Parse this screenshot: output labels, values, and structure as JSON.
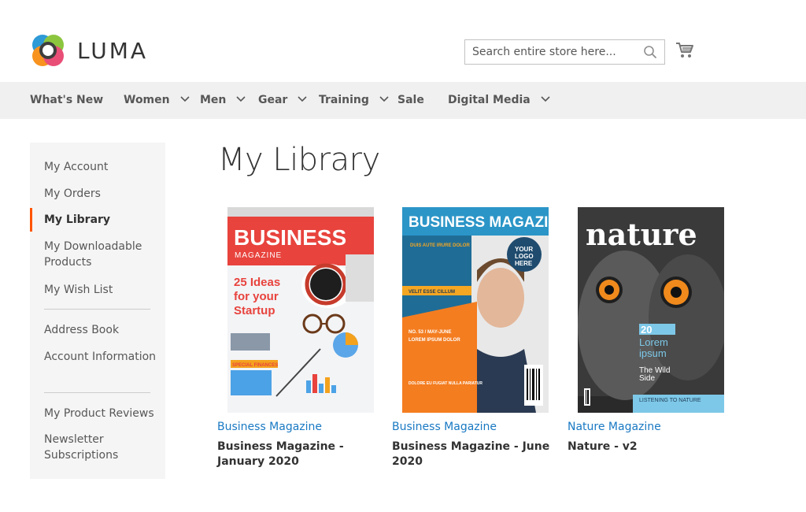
{
  "header": {
    "logo_text": "LUMA",
    "search_placeholder": "Search entire store here...",
    "search_icon": "search-icon",
    "cart_icon": "cart-icon"
  },
  "nav": {
    "items": [
      {
        "label": "What's New",
        "has_dropdown": false
      },
      {
        "label": "Women",
        "has_dropdown": true
      },
      {
        "label": "Men",
        "has_dropdown": true
      },
      {
        "label": "Gear",
        "has_dropdown": true
      },
      {
        "label": "Training",
        "has_dropdown": true
      },
      {
        "label": "Sale",
        "has_dropdown": false
      },
      {
        "label": "Digital Media",
        "has_dropdown": true
      }
    ]
  },
  "sidebar": {
    "items": [
      {
        "label": "My Account"
      },
      {
        "label": "My Orders"
      },
      {
        "label": "My Library",
        "active": true
      },
      {
        "label": "My Downloadable Products"
      },
      {
        "label": "My Wish List"
      },
      {
        "label": "Address Book"
      },
      {
        "label": "Account Information"
      },
      {
        "label": "My Product Reviews"
      },
      {
        "label": "Newsletter Subscriptions"
      }
    ]
  },
  "main": {
    "title": "My Library",
    "products": [
      {
        "category": "Business Magazine",
        "name": "Business Magazine - January 2020",
        "cover": {
          "masthead": "BUSINESS",
          "sub": "MAGAZINE",
          "headline": "25 Ideas for your Startup",
          "tag": "SPECIAL FINANCES"
        }
      },
      {
        "category": "Business Magazine",
        "name": "Business Magazine - June 2020",
        "cover": {
          "masthead": "BUSINESS MAGAZINE",
          "logo": "YOUR LOGO HERE",
          "line1": "DUIS AUTE IRURE DOLOR",
          "line2": "VELIT ESSE CILLUM",
          "line3": "NO. 53 / MAY-JUNE",
          "line4": "LOREM IPSUM DOLOR",
          "line5": "DOLORE EU FUGIAT NULLA PARIATUR"
        }
      },
      {
        "category": "Nature Magazine",
        "name": "Nature - v2",
        "cover": {
          "masthead": "nature",
          "big_num": "20",
          "big_text1": "Lorem",
          "big_text2": "ipsum",
          "sub1": "The Wild",
          "sub2": "Side",
          "footer": "LISTENING TO NATURE"
        }
      }
    ]
  },
  "colors": {
    "accent": "#ff5501",
    "link": "#1979c3",
    "nav_bg": "#f0f0f0",
    "sidebar_bg": "#f5f5f5"
  }
}
